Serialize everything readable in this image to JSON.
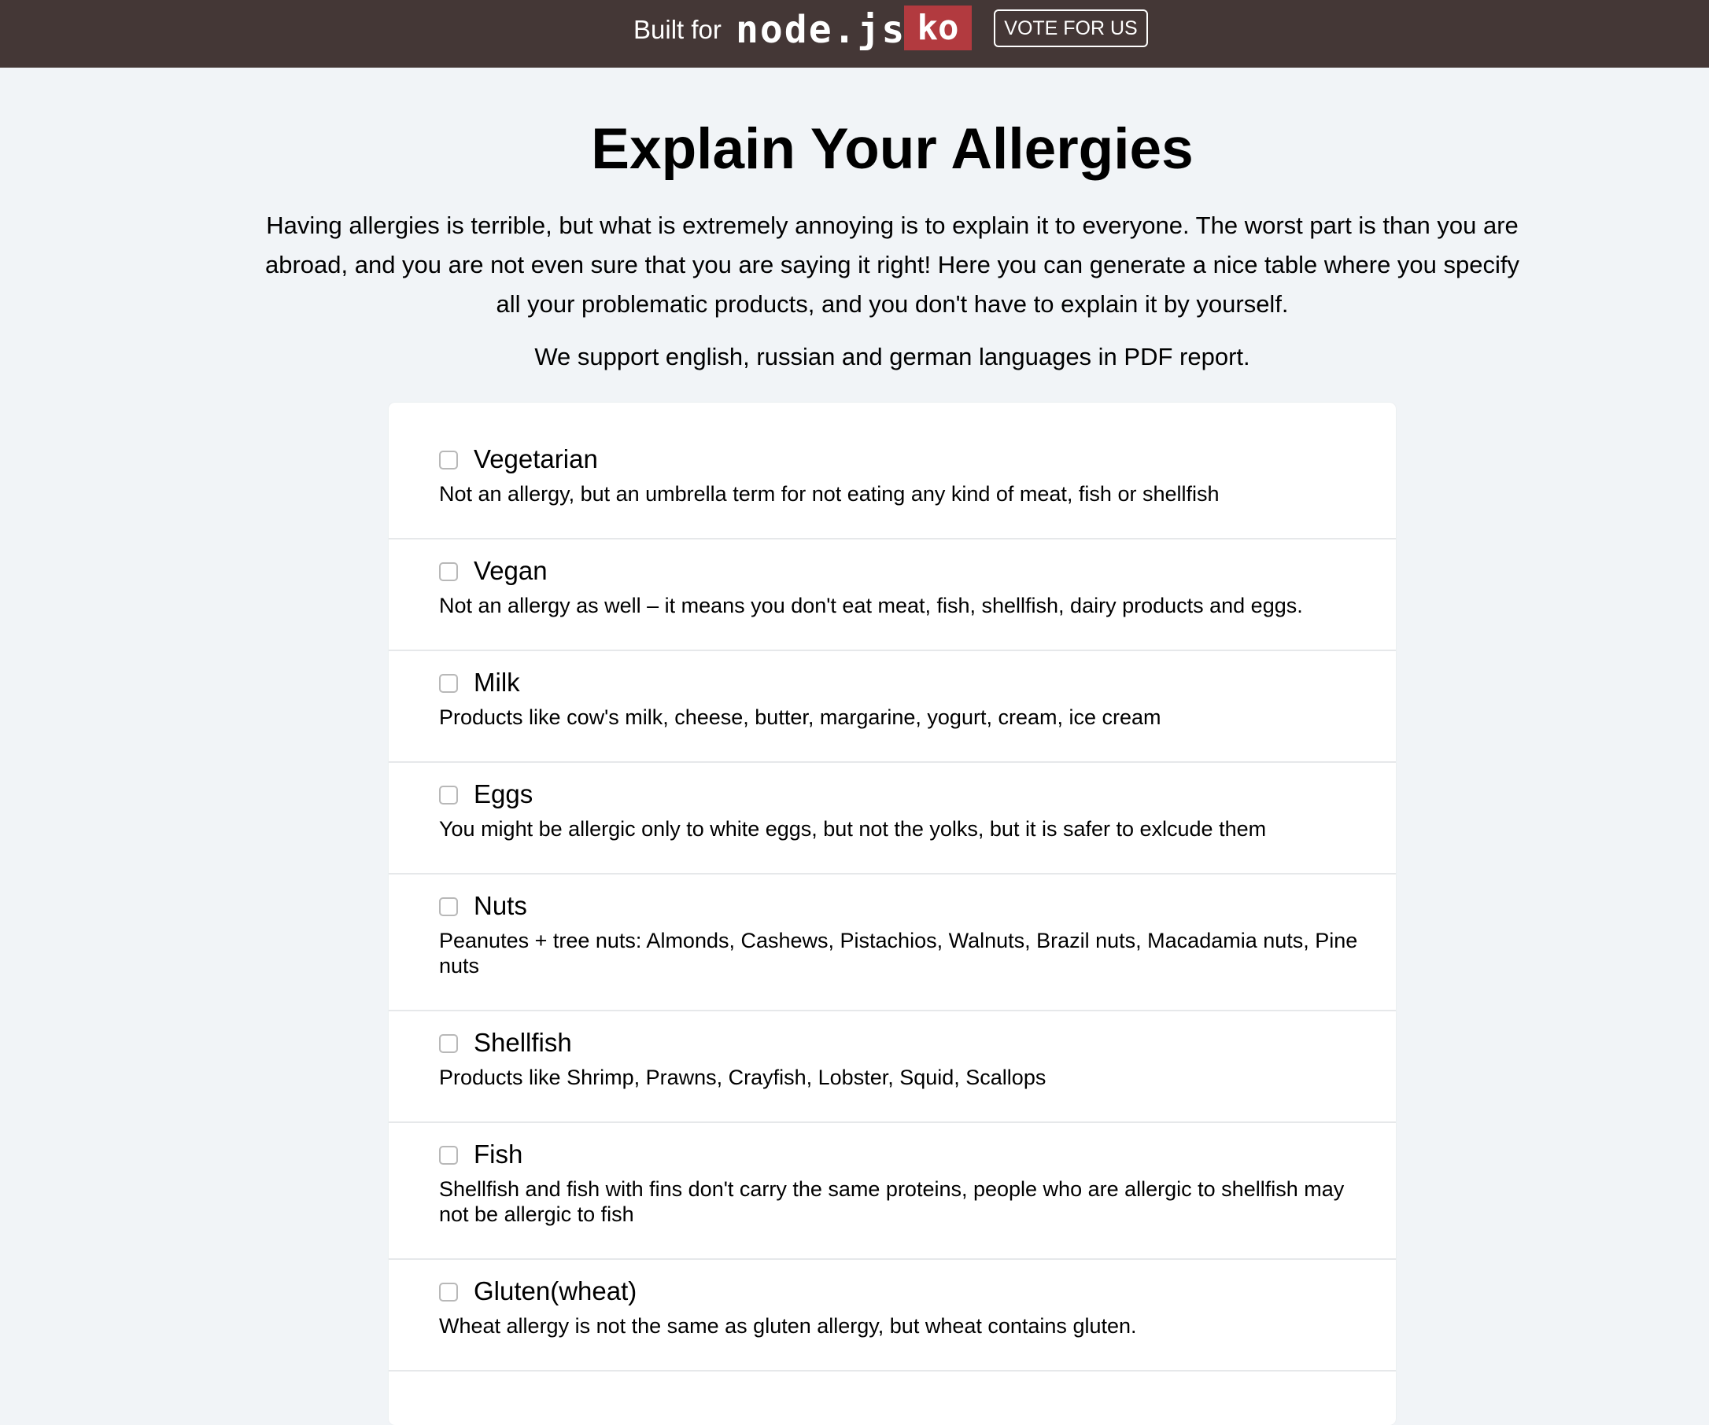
{
  "topbar": {
    "built_for": "Built for",
    "nodejs_logo": "node.js",
    "ko_logo": "ko",
    "vote_label": "VOTE FOR US"
  },
  "main": {
    "title": "Explain Your Allergies",
    "intro": "Having allergies is terrible, but what is extremely annoying is to explain it to everyone. The worst part is than you are abroad, and you are not even sure that you are saying it right! Here you can generate a nice table where you specify all your problematic products, and you don't have to explain it by yourself.",
    "support_note": "We support english, russian and german languages in PDF report."
  },
  "allergies": [
    {
      "label": "Vegetarian",
      "description": "Not an allergy, but an umbrella term for not eating any kind of meat, fish or shellfish",
      "checked": false
    },
    {
      "label": "Vegan",
      "description": "Not an allergy as well – it means you don't eat meat, fish, shellfish, dairy products and eggs.",
      "checked": false
    },
    {
      "label": "Milk",
      "description": "Products like cow's milk, cheese, butter, margarine, yogurt, cream, ice cream",
      "checked": false
    },
    {
      "label": "Eggs",
      "description": "You might be allergic only to white eggs, but not the yolks, but it is safer to exlcude them",
      "checked": false
    },
    {
      "label": "Nuts",
      "description": "Peanutes + tree nuts: Almonds, Cashews, Pistachios, Walnuts, Brazil nuts, Macadamia nuts, Pine nuts",
      "checked": false
    },
    {
      "label": "Shellfish",
      "description": "Products like Shrimp, Prawns, Crayfish, Lobster, Squid, Scallops",
      "checked": false
    },
    {
      "label": "Fish",
      "description": "Shellfish and fish with fins don't carry the same proteins, people who are allergic to shellfish may not be allergic to fish",
      "checked": false
    },
    {
      "label": "Gluten(wheat)",
      "description": "Wheat allergy is not the same as gluten allergy, but wheat contains gluten.",
      "checked": false
    }
  ]
}
